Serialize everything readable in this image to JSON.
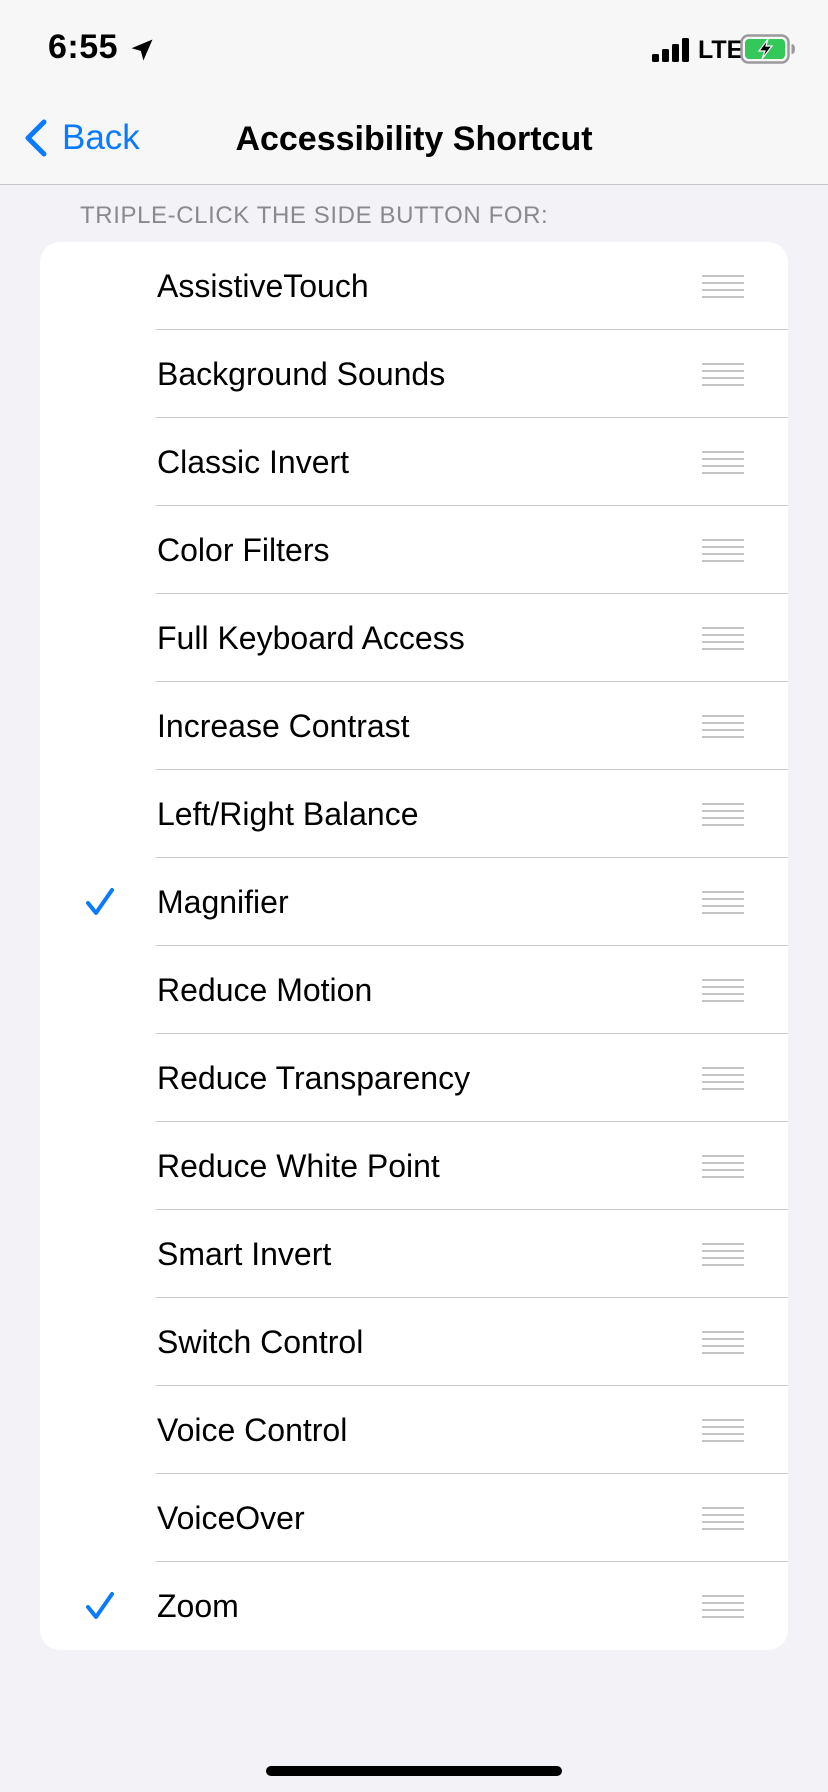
{
  "status_bar": {
    "time": "6:55",
    "network": "LTE",
    "icons": [
      "location-arrow-icon",
      "cellular-signal-icon",
      "battery-charging-icon"
    ],
    "battery_color": "#34c759"
  },
  "nav": {
    "back_label": "Back",
    "title": "Accessibility Shortcut"
  },
  "section": {
    "header": "TRIPLE-CLICK THE SIDE BUTTON FOR:"
  },
  "accent_color": "#0a7aff",
  "options": [
    {
      "label": "AssistiveTouch",
      "checked": false
    },
    {
      "label": "Background Sounds",
      "checked": false
    },
    {
      "label": "Classic Invert",
      "checked": false
    },
    {
      "label": "Color Filters",
      "checked": false
    },
    {
      "label": "Full Keyboard Access",
      "checked": false
    },
    {
      "label": "Increase Contrast",
      "checked": false
    },
    {
      "label": "Left/Right Balance",
      "checked": false
    },
    {
      "label": "Magnifier",
      "checked": true
    },
    {
      "label": "Reduce Motion",
      "checked": false
    },
    {
      "label": "Reduce Transparency",
      "checked": false
    },
    {
      "label": "Reduce White Point",
      "checked": false
    },
    {
      "label": "Smart Invert",
      "checked": false
    },
    {
      "label": "Switch Control",
      "checked": false
    },
    {
      "label": "Voice Control",
      "checked": false
    },
    {
      "label": "VoiceOver",
      "checked": false
    },
    {
      "label": "Zoom",
      "checked": true
    }
  ]
}
